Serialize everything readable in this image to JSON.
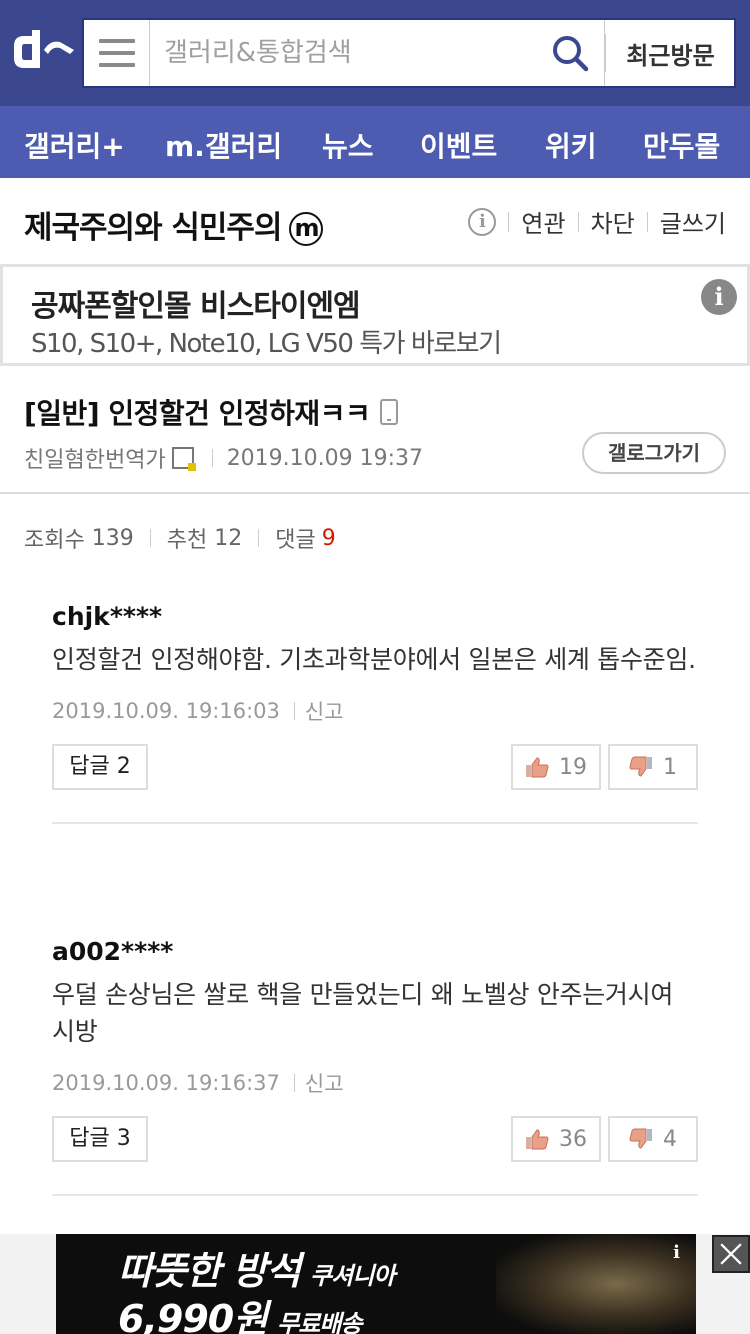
{
  "header": {
    "search_placeholder": "갤러리&통합검색",
    "recent_label": "최근방문",
    "brand_color": "#3b4890"
  },
  "nav": {
    "items": [
      "갤러리+",
      "m.갤러리",
      "뉴스",
      "이벤트",
      "위키",
      "만두몰"
    ]
  },
  "gallery": {
    "title": "제국주의와 식민주의",
    "badge": "m",
    "actions": [
      "연관",
      "차단",
      "글쓰기"
    ]
  },
  "ad": {
    "title": "공짜폰할인몰 비스타이엔엠",
    "subtitle": "S10, S10+, Note10, LG V50 특가 바로보기"
  },
  "post": {
    "title": "[일반] 인정할건 인정하재ㅋㅋ",
    "author": "친일혐한번역가",
    "datetime": "2019.10.09 19:37",
    "gallog_label": "갤로그가기"
  },
  "stats": {
    "views_label": "조회수",
    "views": "139",
    "recommend_label": "추천",
    "recommend": "12",
    "comments_label": "댓글",
    "comments": "9"
  },
  "comments": [
    {
      "author": "chjk****",
      "text": "인정할건 인정해야함. 기초과학분야에서 일본은 세계 톱수준임.",
      "datetime": "2019.10.09. 19:16:03",
      "report": "신고",
      "reply_label": "답글 2",
      "up": "19",
      "down": "1"
    },
    {
      "author": "a002****",
      "text": "우덜 손상님은 쌀로 핵을 만들었는디 왜 노벨상 안주는거시여 시방",
      "datetime": "2019.10.09. 19:16:37",
      "report": "신고",
      "reply_label": "답글 3",
      "up": "36",
      "down": "4"
    }
  ],
  "banner": {
    "line1": "따뜻한 방석",
    "line1_small": "쿠셔니아",
    "line2": "6,990원",
    "line2_small": "무료배송",
    "info": "i"
  }
}
